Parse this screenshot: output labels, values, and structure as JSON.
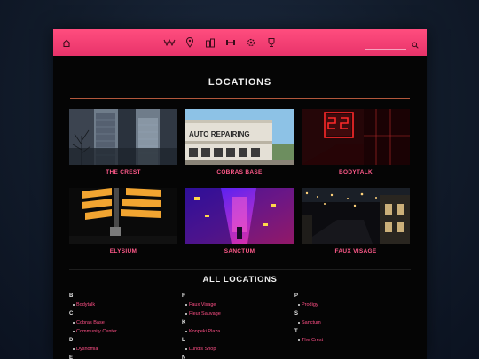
{
  "header": {
    "nav_icons": [
      "home-icon",
      "crest-logo-icon",
      "map-pin-icon",
      "buildings-icon",
      "dumbbell-icon",
      "gear-icon",
      "trophy-icon"
    ],
    "search_placeholder": "",
    "search_icon": "search-icon"
  },
  "main": {
    "title": "LOCATIONS",
    "featured": [
      {
        "label": "THE CREST"
      },
      {
        "label": "COBRAS BASE",
        "sign_text": "AUTO REPAIRING"
      },
      {
        "label": "BODYTALK"
      },
      {
        "label": "ELYSIUM"
      },
      {
        "label": "SANCTUM"
      },
      {
        "label": "FAUX VISAGE"
      }
    ],
    "all_title": "ALL LOCATIONS",
    "index": [
      {
        "groups": [
          {
            "letter": "B",
            "items": [
              "Bodytalk"
            ]
          },
          {
            "letter": "C",
            "items": [
              "Cobras Base",
              "Community Center"
            ]
          },
          {
            "letter": "D",
            "items": [
              "Dysnomia"
            ]
          },
          {
            "letter": "E",
            "items": []
          }
        ]
      },
      {
        "groups": [
          {
            "letter": "F",
            "items": [
              "Faux Visage",
              "Fleur Sauvage"
            ]
          },
          {
            "letter": "K",
            "items": [
              "Konpeki Plaza"
            ]
          },
          {
            "letter": "L",
            "items": [
              "Lund's Shop"
            ]
          },
          {
            "letter": "N",
            "items": []
          }
        ]
      },
      {
        "groups": [
          {
            "letter": "P",
            "items": [
              "Prodigy"
            ]
          },
          {
            "letter": "S",
            "items": [
              "Sanctum"
            ]
          },
          {
            "letter": "T",
            "items": [
              "The Crest"
            ]
          }
        ]
      }
    ]
  },
  "colors": {
    "accent": "#ff4d7e",
    "label": "#ff5a8a",
    "rule": "#b2573c",
    "background": "#050505"
  }
}
